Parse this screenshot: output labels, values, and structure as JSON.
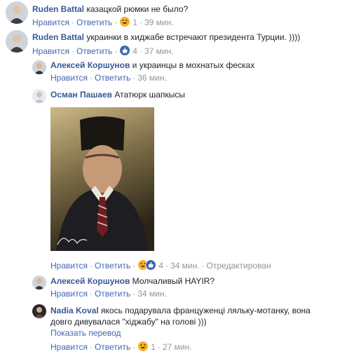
{
  "labels": {
    "like": "Нравится",
    "reply": "Ответить",
    "edited": "Отредактирован",
    "translate": "Показать перевод"
  },
  "comments": [
    {
      "author": "Ruden Battal",
      "text": "казацкой рюмки не было?",
      "reaction": "haha-icon",
      "count": "1",
      "time": "39 мин."
    },
    {
      "author": "Ruden Battal",
      "text": "украинки в хиджабе встречают президента Турции. ))))",
      "reaction": "like-icon",
      "count": "4",
      "time": "37 мин."
    },
    {
      "author": "Алексей Коршунов",
      "text": "и украинцы в мохнатых фесках",
      "time": "36 мин."
    },
    {
      "author": "Осман Пашаев",
      "text": "Ататюрк шапкысы",
      "reactions": [
        "haha-icon",
        "like-icon"
      ],
      "count": "4",
      "time": "34 мин.",
      "edited": true
    },
    {
      "author": "Алексей Коршунов",
      "text": "Молчаливый HAYIR?",
      "time": "34 мин."
    },
    {
      "author": "Nadia Koval",
      "text_line1": "якось подарувала француженці ляльку-мотанку, вона",
      "text_line2": "довго дивувалася \"хіджабу\" на голові )))",
      "reaction": "haha-icon",
      "count": "1",
      "time": "27 мин."
    }
  ],
  "colors": {
    "author": "#385898",
    "link": "#4267b2",
    "meta": "#90949c",
    "text": "#1d2129"
  }
}
